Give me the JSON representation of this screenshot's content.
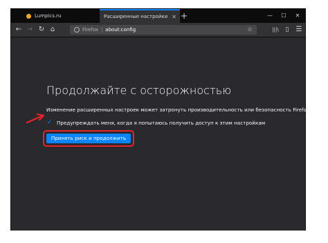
{
  "tabs": [
    {
      "title": "Lumpics.ru",
      "close": "✕"
    },
    {
      "title": "Расширенные настройки",
      "close": "✕"
    }
  ],
  "new_tab": "+",
  "window_controls": {
    "minimize": "—",
    "maximize": "☐",
    "close": "✕"
  },
  "nav": {
    "back": "←",
    "forward": "→",
    "reload": "↻",
    "home": "⌂",
    "library": "|||\\",
    "sidebar": "▯",
    "menu": "☰"
  },
  "urlbar": {
    "brand": "Firefox",
    "url": "about:config",
    "star": "☆"
  },
  "page": {
    "heading": "Продолжайте с осторожностью",
    "description": "Изменение расширенных настроек может затронуть производительность или безопасность Firefox.",
    "checkbox_label": "Предупреждать меня, когда я попытаюсь получить доступ к этим настройкам",
    "checkbox_checked": "✓",
    "accept_button": "Принять риск и продолжить"
  },
  "colors": {
    "accent": "#0a84ff",
    "highlight": "#e8232a",
    "background": "#2a2a2e"
  }
}
